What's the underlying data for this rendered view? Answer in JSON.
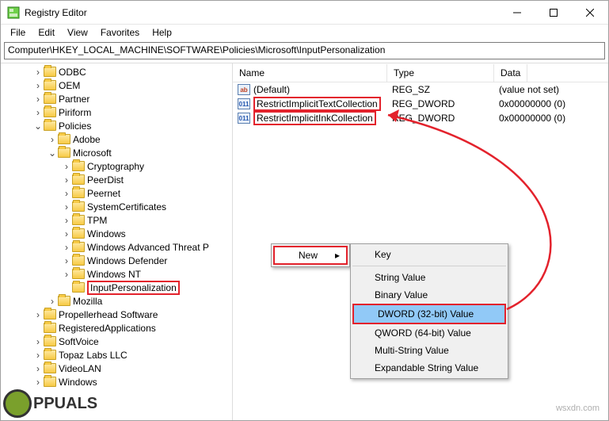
{
  "window": {
    "title": "Registry Editor"
  },
  "menu": {
    "file": "File",
    "edit": "Edit",
    "view": "View",
    "favorites": "Favorites",
    "help": "Help"
  },
  "address": "Computer\\HKEY_LOCAL_MACHINE\\SOFTWARE\\Policies\\Microsoft\\InputPersonalization",
  "tree": {
    "odbc": "ODBC",
    "oem": "OEM",
    "partner": "Partner",
    "piriform": "Piriform",
    "policies": "Policies",
    "adobe": "Adobe",
    "microsoft": "Microsoft",
    "crypt": "Cryptography",
    "peerdist": "PeerDist",
    "peernet": "Peernet",
    "syscert": "SystemCertificates",
    "tpm": "TPM",
    "win": "Windows",
    "watp": "Windows Advanced Threat P",
    "wdef": "Windows Defender",
    "wnt": "Windows NT",
    "inputp": "InputPersonalization",
    "mozilla": "Mozilla",
    "propel": "Propellerhead Software",
    "regapp": "RegisteredApplications",
    "softvoice": "SoftVoice",
    "topaz": "Topaz Labs LLC",
    "videolan": "VideoLAN",
    "winroot": "Windows"
  },
  "columns": {
    "name": "Name",
    "type": "Type",
    "data": "Data"
  },
  "rows": [
    {
      "icon": "ab",
      "name": "(Default)",
      "type": "REG_SZ",
      "data": "(value not set)",
      "box": false
    },
    {
      "icon": "011",
      "name": "RestrictImplicitTextCollection",
      "type": "REG_DWORD",
      "data": "0x00000000 (0)",
      "box": true
    },
    {
      "icon": "011",
      "name": "RestrictImplicitInkCollection",
      "type": "REG_DWORD",
      "data": "0x00000000 (0)",
      "box": true
    }
  ],
  "ctx1": {
    "new": "New"
  },
  "ctx2": {
    "key": "Key",
    "string": "String Value",
    "binary": "Binary Value",
    "dword": "DWORD (32-bit) Value",
    "qword": "QWORD (64-bit) Value",
    "multi": "Multi-String Value",
    "expand": "Expandable String Value"
  },
  "watermark": "wsxdn.com",
  "logo": "PPUALS"
}
